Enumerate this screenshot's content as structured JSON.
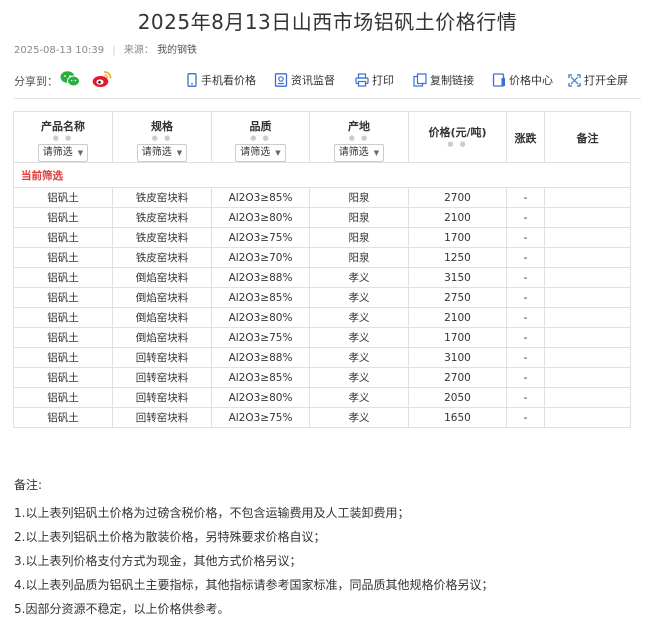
{
  "page": {
    "title": "2025年8月13日山西市场铝矾土价格行情",
    "date": "2025-08-13 10:39",
    "source_label": "来源：",
    "source_name": "我的钢铁"
  },
  "share": {
    "label": "分享到：",
    "icons": [
      "wechat-icon",
      "weibo-icon"
    ]
  },
  "tools": [
    {
      "label": "手机看价格",
      "icon": "mobile-icon"
    },
    {
      "label": "资讯监督",
      "icon": "monitor-icon"
    },
    {
      "label": "打印",
      "icon": "printer-icon"
    },
    {
      "label": "复制链接",
      "icon": "link-icon"
    },
    {
      "label": "价格中心",
      "icon": "price-center-icon"
    },
    {
      "label": "打开全屏",
      "icon": "fullscreen-icon"
    }
  ],
  "table": {
    "headers": [
      "产品名称",
      "规格",
      "品质",
      "产地",
      "价格(元/吨)",
      "涨跌",
      "备注"
    ],
    "filter_label": "请筛选",
    "current_filter_label": "当前筛选",
    "rows": [
      [
        "铝矾土",
        "铁皮窑块料",
        "Al2O3≥85%",
        "阳泉",
        "2700",
        "-",
        ""
      ],
      [
        "铝矾土",
        "铁皮窑块料",
        "Al2O3≥80%",
        "阳泉",
        "2100",
        "-",
        ""
      ],
      [
        "铝矾土",
        "铁皮窑块料",
        "Al2O3≥75%",
        "阳泉",
        "1700",
        "-",
        ""
      ],
      [
        "铝矾土",
        "铁皮窑块料",
        "Al2O3≥70%",
        "阳泉",
        "1250",
        "-",
        ""
      ],
      [
        "铝矾土",
        "倒焰窑块料",
        "Al2O3≥88%",
        "孝义",
        "3150",
        "-",
        ""
      ],
      [
        "铝矾土",
        "倒焰窑块料",
        "Al2O3≥85%",
        "孝义",
        "2750",
        "-",
        ""
      ],
      [
        "铝矾土",
        "倒焰窑块料",
        "Al2O3≥80%",
        "孝义",
        "2100",
        "-",
        ""
      ],
      [
        "铝矾土",
        "倒焰窑块料",
        "Al2O3≥75%",
        "孝义",
        "1700",
        "-",
        ""
      ],
      [
        "铝矾土",
        "回转窑块料",
        "Al2O3≥88%",
        "孝义",
        "3100",
        "-",
        ""
      ],
      [
        "铝矾土",
        "回转窑块料",
        "Al2O3≥85%",
        "孝义",
        "2700",
        "-",
        ""
      ],
      [
        "铝矾土",
        "回转窑块料",
        "Al2O3≥80%",
        "孝义",
        "2050",
        "-",
        ""
      ],
      [
        "铝矾土",
        "回转窑块料",
        "Al2O3≥75%",
        "孝义",
        "1650",
        "-",
        ""
      ]
    ]
  },
  "notes": {
    "heading": "备注:",
    "items": [
      "1.以上表列铝矾土价格为过磅含税价格，不包含运输费用及人工装卸费用；",
      "2.以上表列铝矾土价格为散装价格，另特殊要求价格自议；",
      "3.以上表列价格支付方式为现金，其他方式价格另议；",
      "4.以上表列品质为铝矾土主要指标，其他指标请参考国家标准，同品质其他规格价格另议；",
      "5.因部分资源不稳定，以上价格供参考。"
    ]
  },
  "colors": {
    "accent_red": "#e03b3b",
    "border": "#e0e0e0",
    "icon_blue": "#3a6fd1"
  }
}
